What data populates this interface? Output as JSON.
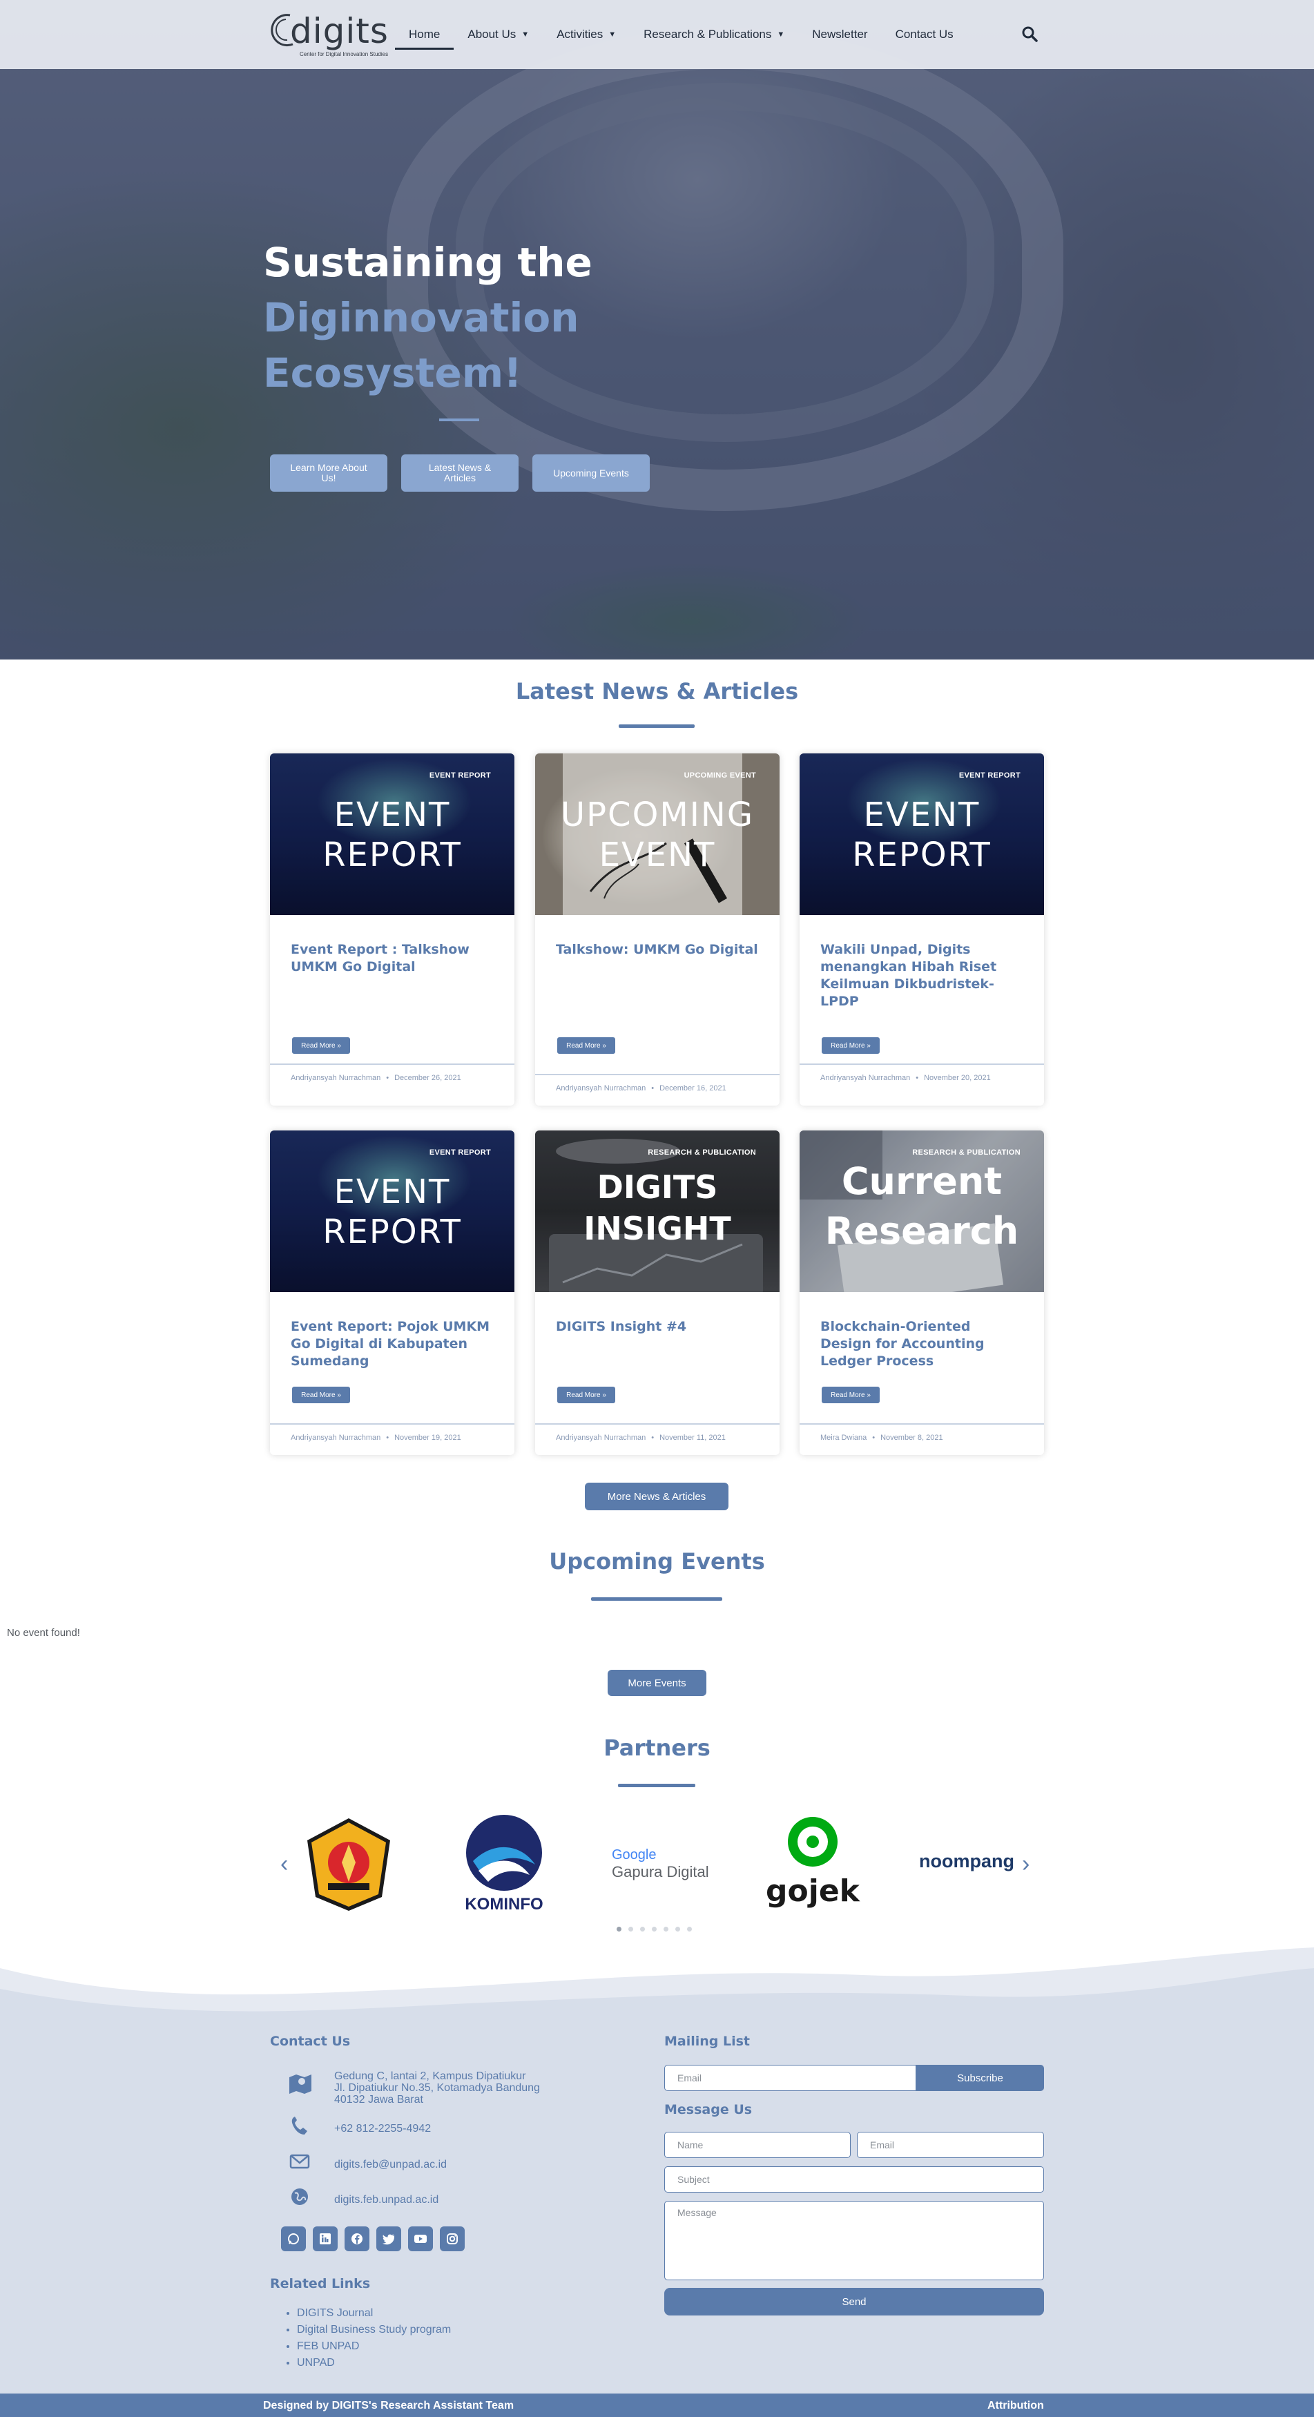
{
  "nav": {
    "logo_text": "digits",
    "logo_tagline": "Center for Digital Innovation Studies",
    "items": [
      {
        "label": "Home"
      },
      {
        "label": "About Us"
      },
      {
        "label": "Activities"
      },
      {
        "label": "Research & Publications"
      },
      {
        "label": "Newsletter"
      },
      {
        "label": "Contact Us"
      }
    ]
  },
  "hero": {
    "line1": "Sustaining the",
    "line2": "Diginnovation",
    "line3": "Ecosystem!",
    "buttons": [
      {
        "label": "Learn More About Us!"
      },
      {
        "label": "Latest News & Articles"
      },
      {
        "label": "Upcoming Events"
      }
    ]
  },
  "news": {
    "title": "Latest News & Articles",
    "read_more": "Read More »",
    "meta_sep": "•",
    "cards": [
      {
        "badge": "EVENT REPORT",
        "thumb_l1": "EVENT",
        "thumb_l2": "REPORT",
        "title": "Event Report : Talkshow UMKM Go Digital",
        "author": "Andriyansyah Nurrachman",
        "date": "December 26, 2021"
      },
      {
        "badge": "UPCOMING EVENT",
        "thumb_l1": "UPCOMING",
        "thumb_l2": "EVENT",
        "title": "Talkshow: UMKM Go Digital",
        "author": "Andriyansyah Nurrachman",
        "date": "December 16, 2021"
      },
      {
        "badge": "EVENT REPORT",
        "thumb_l1": "EVENT",
        "thumb_l2": "REPORT",
        "title": "Wakili Unpad, Digits menangkan Hibah Riset Keilmuan Dikbudristek-LPDP",
        "author": "Andriyansyah Nurrachman",
        "date": "November 20, 2021"
      },
      {
        "badge": "EVENT REPORT",
        "thumb_l1": "EVENT",
        "thumb_l2": "REPORT",
        "title": "Event Report: Pojok UMKM Go Digital di Kabupaten Sumedang",
        "author": "Andriyansyah Nurrachman",
        "date": "November 19, 2021"
      },
      {
        "badge": "RESEARCH & PUBLICATION",
        "thumb_l1": "DIGITS",
        "thumb_l2": "INSIGHT",
        "title": "DIGITS Insight #4",
        "author": "Andriyansyah Nurrachman",
        "date": "November 11, 2021"
      },
      {
        "badge": "RESEARCH & PUBLICATION",
        "thumb_l1": "Current",
        "thumb_l2": "Research",
        "title": "Blockchain-Oriented Design for Accounting Ledger Process",
        "author": "Meira Dwiana",
        "date": "November 8, 2021"
      }
    ],
    "more_label": "More News & Articles"
  },
  "events": {
    "title": "Upcoming Events",
    "empty_text": "No event found!",
    "more_label": "More Events"
  },
  "partners": {
    "title": "Partners",
    "logos": [
      {
        "name": "Universitas Padjadjaran seal",
        "text": ""
      },
      {
        "name": "Kominfo",
        "text": "KOMINFO"
      },
      {
        "name": "Google Gapura Digital",
        "text_google": "Google",
        "text": "Gapura Digital"
      },
      {
        "name": "Gojek",
        "text": "gojek"
      },
      {
        "name": "Numpang",
        "text": "noompang"
      }
    ]
  },
  "footer": {
    "contact_title": "Contact Us",
    "address": [
      "Gedung C, lantai 2, Kampus Dipatiukur",
      "Jl. Dipatiukur No.35, Kotamadya Bandung",
      "40132 Jawa Barat"
    ],
    "phone": "+62 812-2255-4942",
    "email": "digits.feb@unpad.ac.id",
    "website": "digits.feb.unpad.ac.id",
    "related_title": "Related Links",
    "related_links": [
      "DIGITS Journal",
      "Digital Business Study program",
      "FEB UNPAD",
      "UNPAD"
    ],
    "mailing_title": "Mailing List",
    "mailing_placeholder": "Email",
    "subscribe_label": "Subscribe",
    "message_title": "Message Us",
    "name_placeholder": "Name",
    "email_placeholder": "Email",
    "subject_placeholder": "Subject",
    "message_placeholder": "Message",
    "send_label": "Send",
    "designed_by": "Designed by DIGITS's Research Assistant Team",
    "attribution": "Attribution"
  },
  "colors": {
    "accent": "#5a7bab",
    "hero_accent": "#7e9dcb",
    "footer_bg": "#d7deea"
  }
}
